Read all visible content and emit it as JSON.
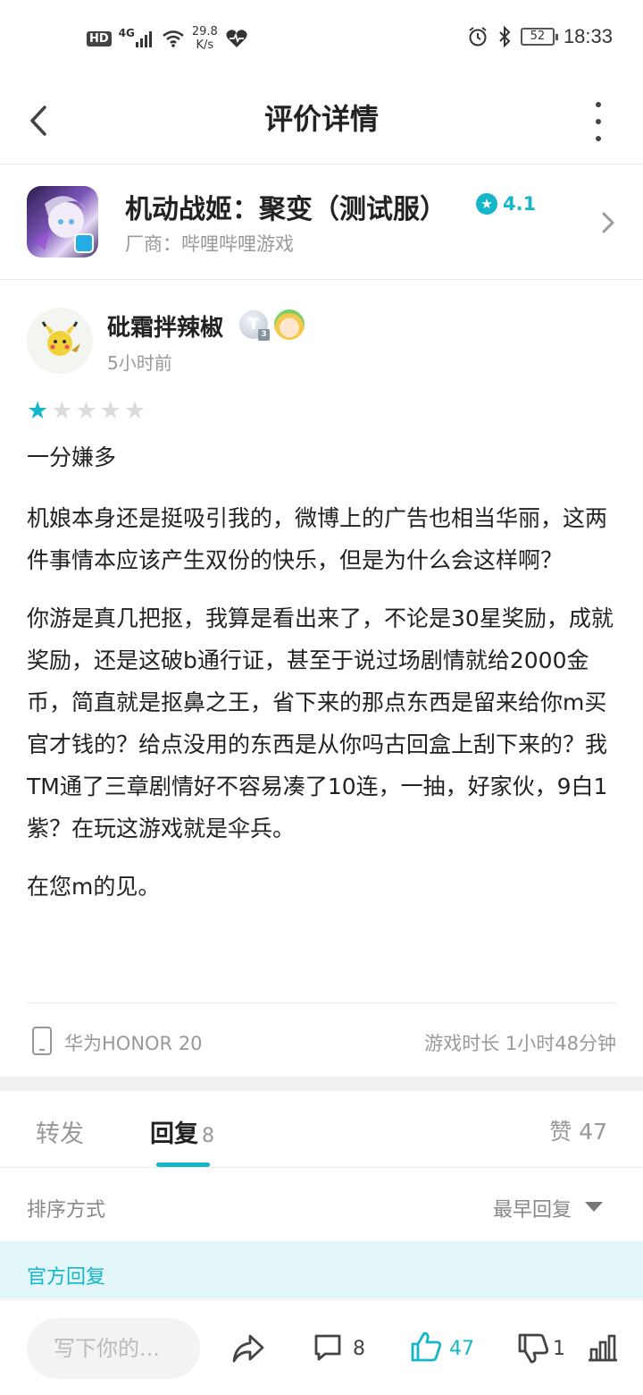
{
  "status_bar": {
    "hd": "HD",
    "network": "4G",
    "speed_value": "29.8",
    "speed_unit": "K/s",
    "battery": "52",
    "time": "18:33"
  },
  "header": {
    "title": "评价详情"
  },
  "app": {
    "name": "机动战姬：聚变（测试服）",
    "rating": "4.1",
    "vendor": "厂商：哔哩哔哩游戏"
  },
  "review": {
    "username": "砒霜拌辣椒",
    "badge_letter": "T",
    "badge_level": "3",
    "time_ago": "5小时前",
    "stars": 1,
    "star_max": 5,
    "title": "一分嫌多",
    "paragraphs": [
      "机娘本身还是挺吸引我的，微博上的广告也相当华丽，这两件事情本应该产生双份的快乐，但是为什么会这样啊？",
      "你游是真几把抠，我算是看出来了，不论是30星奖励，成就奖励，还是这破b通行证，甚至于说过场剧情就给2000金币，简直就是抠鼻之王，省下来的那点东西是留来给你m买官才钱的？给点没用的东西是从你吗古回盒上刮下来的？我TM通了三章剧情好不容易凑了10连，一抽，好家伙，9白1紫？在玩这游戏就是伞兵。",
      "在您m的见。"
    ],
    "device": "华为HONOR 20",
    "play_time": "游戏时长 1小时48分钟"
  },
  "tabs": {
    "forward": "转发",
    "reply": "回复",
    "reply_count": "8",
    "like": "赞 47"
  },
  "sort": {
    "label": "排序方式",
    "value": "最早回复"
  },
  "official_reply": "官方回复",
  "bottom_bar": {
    "placeholder": "写下你的...",
    "comment_count": "8",
    "like_count": "47",
    "dislike_count": "1"
  },
  "colors": {
    "accent": "#15b6c8"
  }
}
